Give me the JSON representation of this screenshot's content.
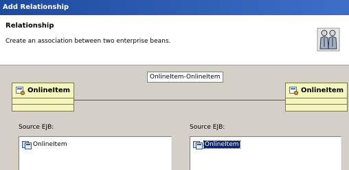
{
  "window": {
    "title": "Add Relationship"
  },
  "header": {
    "title": "Relationship",
    "description": "Create an association between two enterprise beans.",
    "icon": "people-icon"
  },
  "diagram": {
    "connection_label": "OnlineItem-OnlineItem",
    "left_bean": {
      "name": "OnlineItem",
      "icon": "bean-icon"
    },
    "right_bean": {
      "name": "OnlineItem",
      "icon": "bean-icon"
    }
  },
  "left_panel": {
    "label": "Source EJB:",
    "items": [
      {
        "label": "OnlineItem",
        "selected": false
      }
    ]
  },
  "right_panel": {
    "label": "Source EJB:",
    "items": [
      {
        "label": "OnlineItem",
        "selected": true
      }
    ]
  }
}
